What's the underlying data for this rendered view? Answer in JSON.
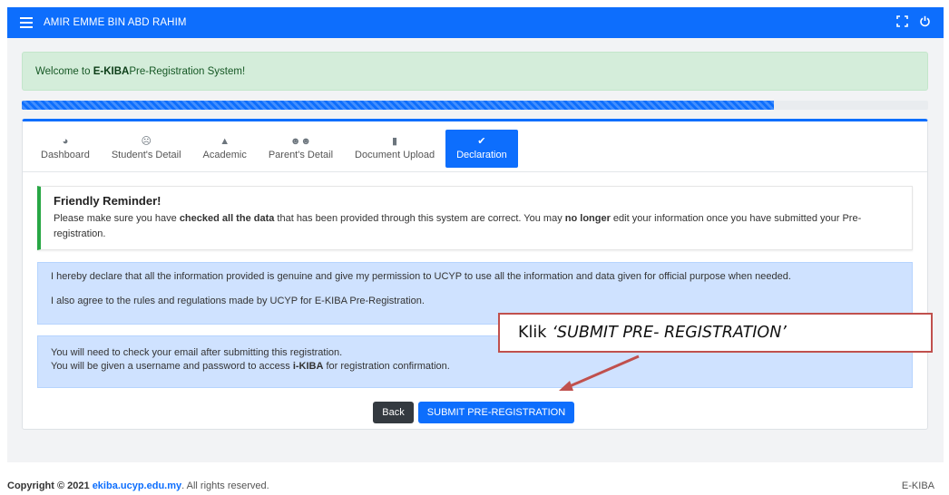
{
  "topbar": {
    "user_name": "AMIR EMME BIN ABD RAHIM",
    "icons": [
      "menu-icon",
      "expand-icon",
      "power-icon"
    ]
  },
  "welcome": {
    "prefix": "Welcome to ",
    "brand": "E-KIBA",
    "suffix": " Pre-Registration System!"
  },
  "progress": {
    "fraction": 0.83
  },
  "tabs": [
    {
      "label": "Dashboard",
      "icon": "dashboard-icon"
    },
    {
      "label": "Student's Detail",
      "icon": "student-icon"
    },
    {
      "label": "Academic",
      "icon": "graduation-cap-icon"
    },
    {
      "label": "Parent's Detail",
      "icon": "users-icon"
    },
    {
      "label": "Document Upload",
      "icon": "file-upload-icon"
    },
    {
      "label": "Declaration",
      "icon": "clipboard-check-icon",
      "active": true
    }
  ],
  "reminder": {
    "title": "Friendly Reminder!",
    "text1": "Please make sure you have ",
    "bold1": "checked all the data",
    "text2": " that has been provided through this system are correct. You may ",
    "bold2": "no longer",
    "text3": " edit your information once you have submitted your Pre-registration."
  },
  "declaration": {
    "line1": "I hereby declare that all the information provided is genuine and give my permission to UCYP to use all the information and data given for official purpose when needed.",
    "line2": "I also agree to the rules and regulations made by UCYP for E-KIBA Pre-Registration."
  },
  "email_notice": {
    "line1": "You will need to check your email after submitting this registration.",
    "line2_a": "You will be given a username and password to access ",
    "line2_b": "i-KIBA",
    "line2_c": " for registration confirmation."
  },
  "buttons": {
    "back": "Back",
    "submit": "SUBMIT PRE-REGISTRATION"
  },
  "annotation": {
    "prefix": "Klik",
    "text": "‘SUBMIT PRE- REGISTRATION’"
  },
  "footer": {
    "copyright": "Copyright © 2021 ",
    "link": "ekiba.ucyp.edu.my",
    "rights": ". All rights reserved.",
    "brand": "E-KIBA"
  },
  "colors": {
    "primary": "#0d6efd",
    "success_bg": "#d4edda",
    "info_bg": "#cfe2ff",
    "annotation_border": "#c0504d"
  }
}
